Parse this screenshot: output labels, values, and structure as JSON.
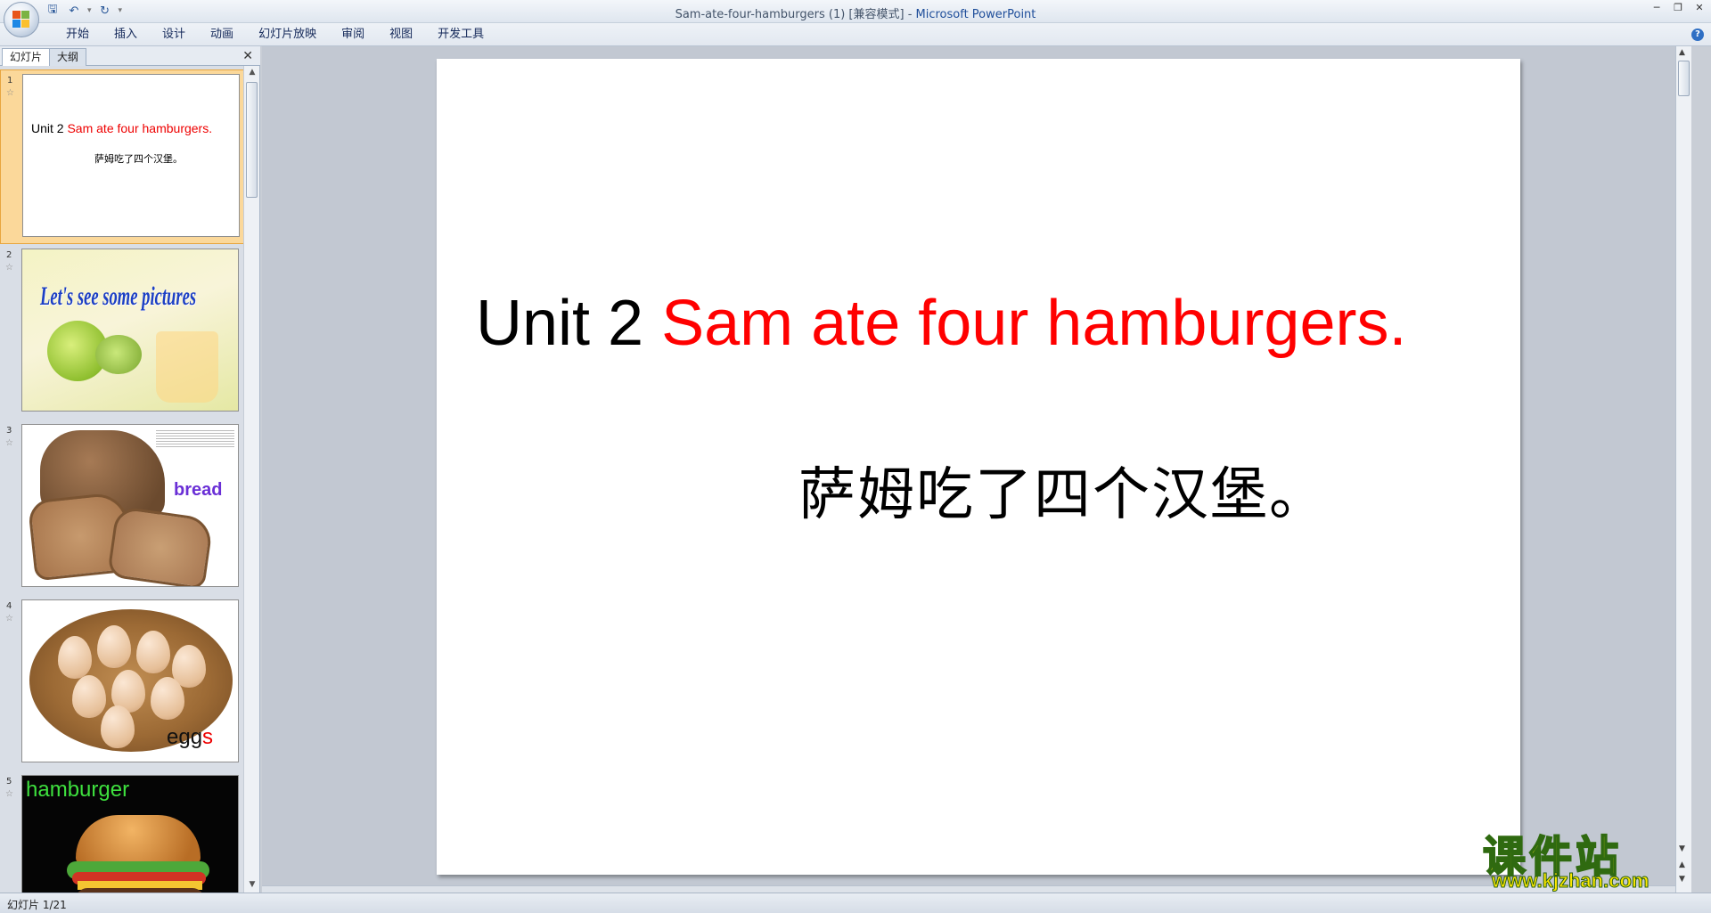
{
  "window": {
    "title": "Sam-ate-four-hamburgers (1) [兼容模式] - ",
    "app_name": "Microsoft PowerPoint"
  },
  "quick_access": {
    "icons": [
      "save-icon",
      "undo-icon",
      "redo-icon",
      "customize-qat-icon"
    ]
  },
  "ribbon": {
    "tabs": [
      "开始",
      "插入",
      "设计",
      "动画",
      "幻灯片放映",
      "审阅",
      "视图",
      "开发工具"
    ]
  },
  "panel": {
    "tab_slides": "幻灯片",
    "tab_outline": "大纲",
    "thumbnails": [
      {
        "number": "1",
        "title_black": "Unit 2 ",
        "title_red": "Sam ate four hamburgers.",
        "subtitle": "萨姆吃了四个汉堡。"
      },
      {
        "number": "2",
        "text": "Let's see some pictures"
      },
      {
        "number": "3",
        "word": "bread"
      },
      {
        "number": "4",
        "word_black": "egg",
        "word_red": "s"
      },
      {
        "number": "5",
        "word": "hamburger"
      }
    ]
  },
  "slide": {
    "title_black": "Unit 2 ",
    "title_red": "Sam ate four hamburgers.",
    "subtitle": "萨姆吃了四个汉堡。"
  },
  "watermark": {
    "main": "课件站",
    "url": "www.kjzhan.com"
  },
  "status": {
    "slide_indicator": "幻灯片 1/21"
  },
  "colors": {
    "title_red": "#ff0000",
    "bread_purple": "#6a2fd6",
    "hamburger_green": "#3ee03e",
    "selected_thumb": "#fbd89a"
  }
}
